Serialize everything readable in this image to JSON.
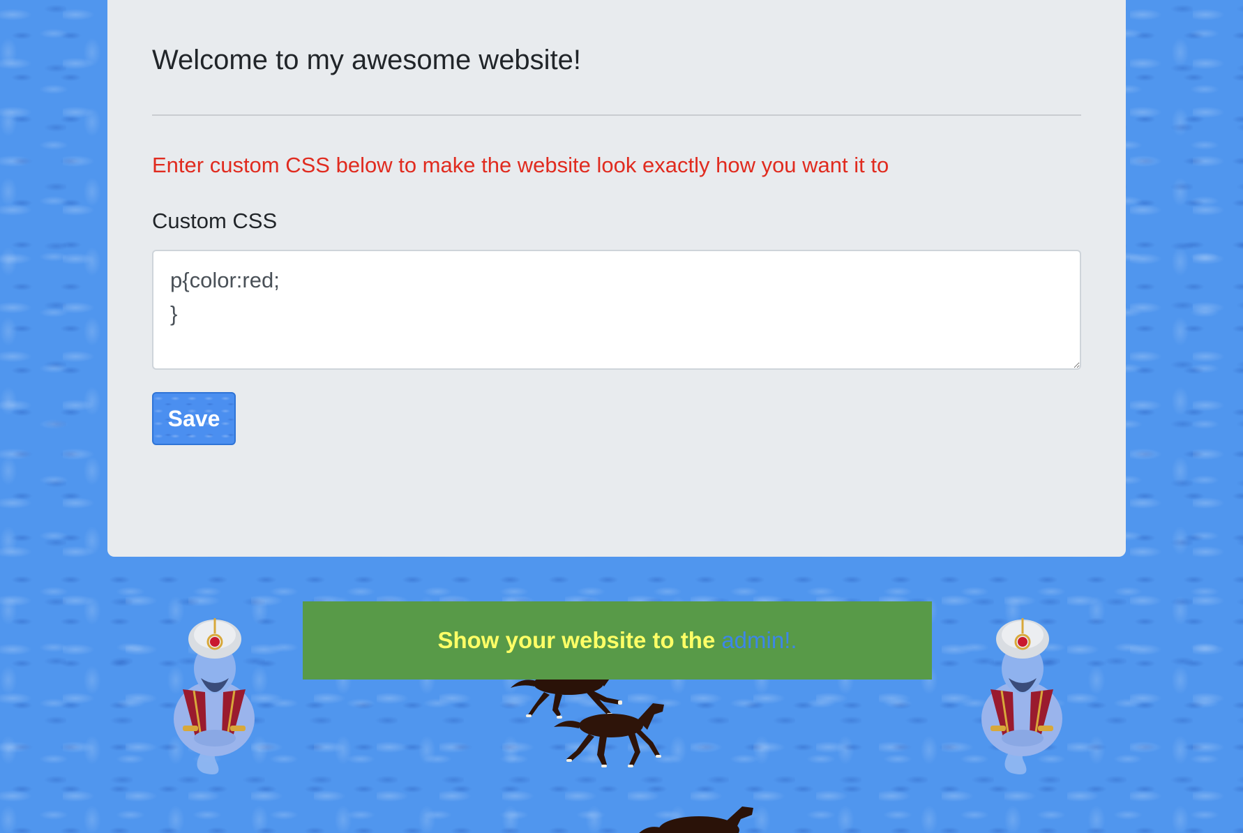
{
  "page": {
    "title": "Welcome to my awesome website!",
    "intro": "Enter custom CSS below to make the website look exactly how you want it to"
  },
  "form": {
    "label": "Custom CSS",
    "css_value": "p{color:red;\n}",
    "save_label": "Save"
  },
  "banner": {
    "text": "Show your website to the",
    "link_text": "admin!."
  },
  "colors": {
    "background": "#5096ee",
    "card": "#e8ebee",
    "intro_text": "#e02b1f",
    "banner": "#589a48",
    "banner_text": "#ffff66",
    "link": "#3d86e8",
    "button": "#4b8ff0"
  },
  "decorations": {
    "left_figure": "genie-figure",
    "right_figure": "genie-figure",
    "animals": "running-horse"
  }
}
